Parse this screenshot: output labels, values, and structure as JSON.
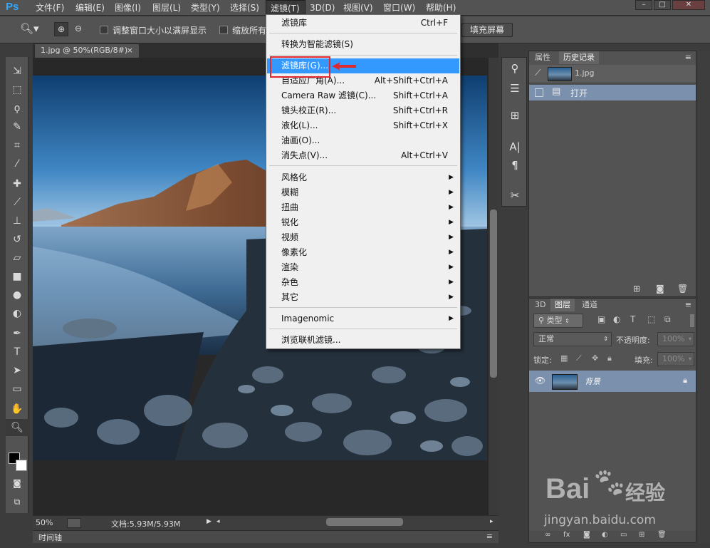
{
  "menubar": {
    "logo": "Ps",
    "items": [
      "文件(F)",
      "编辑(E)",
      "图像(I)",
      "图层(L)",
      "类型(Y)",
      "选择(S)",
      "滤镜(T)",
      "3D(D)",
      "视图(V)",
      "窗口(W)",
      "帮助(H)"
    ],
    "active_index": 6
  },
  "options": {
    "checkbox1_label": "调整窗口大小以满屏显示",
    "checkbox2_label": "缩放所有",
    "fill_button": "填充屏幕"
  },
  "document": {
    "tab_label": "1.jpg @ 50%(RGB/8#)",
    "close_glyph": "×"
  },
  "status": {
    "zoom": "50%",
    "doc_size": "文档:5.93M/5.93M"
  },
  "timeline_label": "时间轴",
  "history_panel": {
    "tabs": [
      "属性",
      "历史记录"
    ],
    "active_tab": 1,
    "snapshot_name": "1.jpg",
    "steps": [
      "打开"
    ]
  },
  "layers_panel": {
    "tabs": [
      "3D",
      "图层",
      "通道"
    ],
    "active_tab": 1,
    "filter_kind": "类型",
    "blend_mode": "正常",
    "opacity_label": "不透明度:",
    "opacity_value": "100%",
    "lock_label": "锁定:",
    "fill_label": "填充:",
    "fill_value": "100%",
    "layers": [
      {
        "name": "背景",
        "locked": true,
        "visible": true
      }
    ]
  },
  "filter_menu": {
    "items": [
      {
        "label": "滤镜库",
        "shortcut": "Ctrl+F"
      },
      {
        "sep": true
      },
      {
        "label": "转换为智能滤镜(S)",
        "shortcut": ""
      },
      {
        "sep": true
      },
      {
        "label": "滤镜库(G)...",
        "shortcut": "",
        "highlight": true
      },
      {
        "label": "自适应广角(A)...",
        "shortcut": "Alt+Shift+Ctrl+A"
      },
      {
        "label": "Camera Raw 滤镜(C)...",
        "shortcut": "Shift+Ctrl+A"
      },
      {
        "label": "镜头校正(R)...",
        "shortcut": "Shift+Ctrl+R"
      },
      {
        "label": "液化(L)...",
        "shortcut": "Shift+Ctrl+X"
      },
      {
        "label": "油画(O)...",
        "shortcut": ""
      },
      {
        "label": "消失点(V)...",
        "shortcut": "Alt+Ctrl+V"
      },
      {
        "sep": true
      },
      {
        "label": "风格化",
        "submenu": true
      },
      {
        "label": "模糊",
        "submenu": true
      },
      {
        "label": "扭曲",
        "submenu": true
      },
      {
        "label": "锐化",
        "submenu": true
      },
      {
        "label": "视频",
        "submenu": true
      },
      {
        "label": "像素化",
        "submenu": true
      },
      {
        "label": "渲染",
        "submenu": true
      },
      {
        "label": "杂色",
        "submenu": true
      },
      {
        "label": "其它",
        "submenu": true
      },
      {
        "sep": true
      },
      {
        "label": "Imagenomic",
        "submenu": true
      },
      {
        "sep": true
      },
      {
        "label": "浏览联机滤镜...",
        "shortcut": ""
      }
    ]
  },
  "watermark": {
    "brand_a": "Bai",
    "brand_b": "经验",
    "url": "jingyan.baidu.com"
  },
  "colors": {
    "highlight": "#3399ff",
    "annotation_red": "#e0282f",
    "logo_blue": "#31a8ff"
  }
}
